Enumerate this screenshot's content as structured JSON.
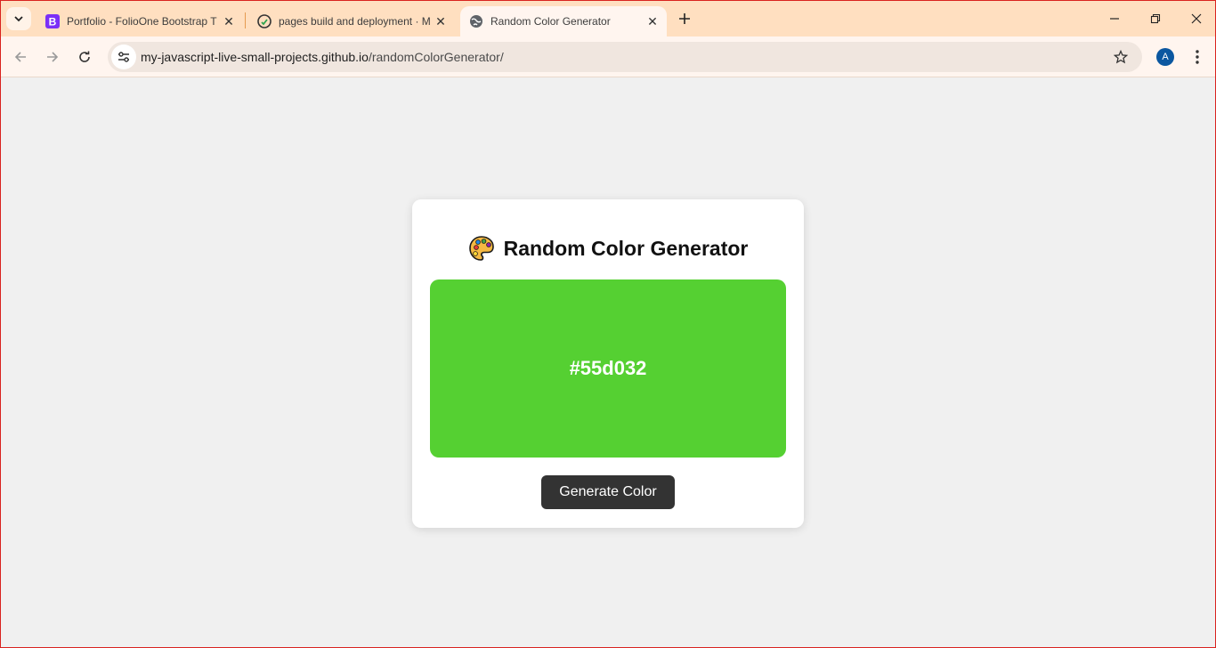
{
  "browser": {
    "tabs": [
      {
        "title": "Portfolio - FolioOne Bootstrap T",
        "favicon": "bootstrap-icon",
        "active": false
      },
      {
        "title": "pages build and deployment · M",
        "favicon": "github-icon",
        "active": false
      },
      {
        "title": "Random Color Generator",
        "favicon": "globe-icon",
        "active": true
      }
    ],
    "url_domain": "my-javascript-live-small-projects.github.io",
    "url_path": "/randomColorGenerator/",
    "profile_initial": "A",
    "colors": {
      "tabstrip": "#ffdfc0",
      "toolbar": "#fff5ef",
      "avatar": "#0b57a0"
    }
  },
  "page": {
    "title": "Random Color Generator",
    "title_icon": "palette-icon",
    "current_color": "#55d032",
    "generate_label": "Generate Color",
    "button_color": "#333333",
    "background": "#f0f0f0"
  }
}
